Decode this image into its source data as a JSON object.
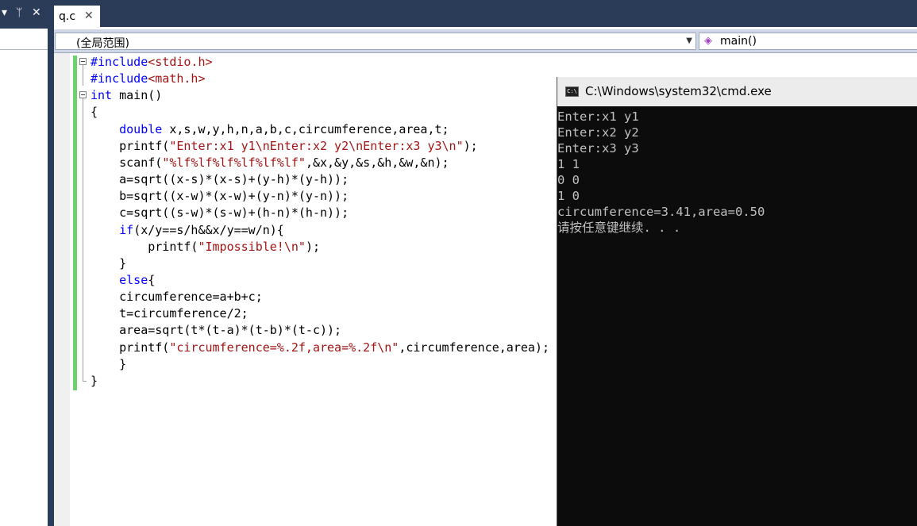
{
  "left_panel": {
    "dropdown_glyph": "▾",
    "pin_glyph": "ᛘ",
    "close_glyph": "✕"
  },
  "tabs": [
    {
      "label": "q.c",
      "close_glyph": "✕",
      "active": true
    }
  ],
  "navbar": {
    "scope": "(全局范围)",
    "scope_arrow": "▼",
    "member_icon": "◈",
    "member": "main()"
  },
  "code_lines": [
    [
      {
        "t": "#include",
        "c": "pp"
      },
      {
        "t": "<stdio.h>",
        "c": "ang"
      }
    ],
    [
      {
        "t": "#include",
        "c": "pp"
      },
      {
        "t": "<math.h>",
        "c": "ang"
      }
    ],
    [
      {
        "t": "int",
        "c": "kw"
      },
      {
        "t": " main()",
        "c": ""
      }
    ],
    [
      {
        "t": "{",
        "c": ""
      }
    ],
    [
      {
        "t": "    ",
        "c": ""
      },
      {
        "t": "double",
        "c": "kw"
      },
      {
        "t": " x,s,w,y,h,n,a,b,c,circumference,area,t;",
        "c": ""
      }
    ],
    [
      {
        "t": "    printf(",
        "c": ""
      },
      {
        "t": "\"Enter:x1 y1\\nEnter:x2 y2\\nEnter:x3 y3\\n\"",
        "c": "str"
      },
      {
        "t": ");",
        "c": ""
      }
    ],
    [
      {
        "t": "    scanf(",
        "c": ""
      },
      {
        "t": "\"%lf%lf%lf%lf%lf%lf\"",
        "c": "str"
      },
      {
        "t": ",&x,&y,&s,&h,&w,&n);",
        "c": ""
      }
    ],
    [
      {
        "t": "    a=sqrt((x-s)*(x-s)+(y-h)*(y-h));",
        "c": ""
      }
    ],
    [
      {
        "t": "    b=sqrt((x-w)*(x-w)+(y-n)*(y-n));",
        "c": ""
      }
    ],
    [
      {
        "t": "    c=sqrt((s-w)*(s-w)+(h-n)*(h-n));",
        "c": ""
      }
    ],
    [
      {
        "t": "    ",
        "c": ""
      },
      {
        "t": "if",
        "c": "kw"
      },
      {
        "t": "(x/y==s/h&&x/y==w/n){",
        "c": ""
      }
    ],
    [
      {
        "t": "        printf(",
        "c": ""
      },
      {
        "t": "\"Impossible!\\n\"",
        "c": "str"
      },
      {
        "t": ");",
        "c": ""
      }
    ],
    [
      {
        "t": "    }",
        "c": ""
      }
    ],
    [
      {
        "t": "    ",
        "c": ""
      },
      {
        "t": "else",
        "c": "kw"
      },
      {
        "t": "{",
        "c": ""
      }
    ],
    [
      {
        "t": "    circumference=a+b+c;",
        "c": ""
      }
    ],
    [
      {
        "t": "    t=circumference/2;",
        "c": ""
      }
    ],
    [
      {
        "t": "    area=sqrt(t*(t-a)*(t-b)*(t-c));",
        "c": ""
      }
    ],
    [
      {
        "t": "    printf(",
        "c": ""
      },
      {
        "t": "\"circumference=%.2f,area=%.2f\\n\"",
        "c": "str"
      },
      {
        "t": ",circumference,area);",
        "c": ""
      }
    ],
    [
      {
        "t": "    }",
        "c": ""
      }
    ],
    [
      {
        "t": "}",
        "c": ""
      }
    ]
  ],
  "console": {
    "title": "C:\\Windows\\system32\\cmd.exe",
    "icon_text": "C:\\",
    "lines": [
      "Enter:x1 y1",
      "Enter:x2 y2",
      "Enter:x3 y3",
      "1 1",
      "0 0",
      "1 0",
      "circumference=3.41,area=0.50",
      "请按任意键继续. . ."
    ]
  },
  "colors": {
    "keyword": "#0000ff",
    "string": "#a31515",
    "chrome": "#2b3c59",
    "change_bar": "#6cd36c",
    "console_bg": "#0c0c0c",
    "console_fg": "#c0c0c0"
  }
}
